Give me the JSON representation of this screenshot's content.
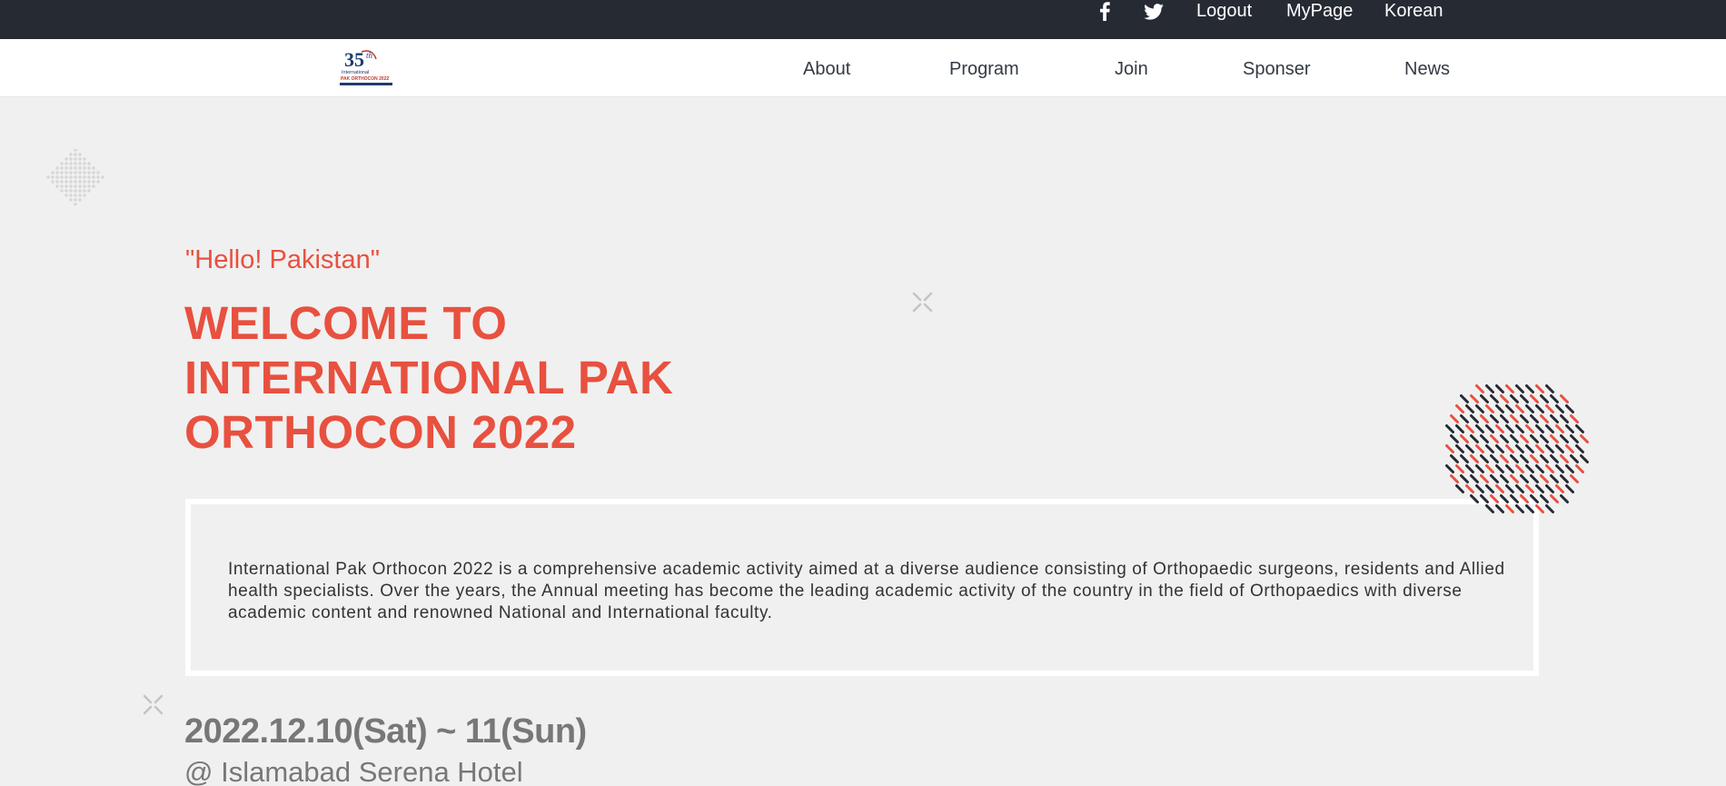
{
  "topbar": {
    "icons": {
      "facebook": "facebook-icon",
      "twitter": "twitter-icon"
    },
    "links": {
      "logout": "Logout",
      "mypage": "MyPage",
      "language": "Korean"
    }
  },
  "navbar": {
    "logo": {
      "badge": "35",
      "suffix": "th",
      "line1": "International",
      "line2": "PAK ORTHOCON 2022"
    },
    "items": [
      "About",
      "Program",
      "Join",
      "Sponser",
      "News"
    ]
  },
  "hero": {
    "subtitle": "\"Hello! Pakistan\"",
    "headline": "WELCOME TO INTERNATIONAL PAK ORTHOCON 2022",
    "description": "International Pak Orthocon 2022 is a comprehensive academic activity aimed at a diverse audience consisting of Orthopaedic surgeons, residents and Allied health specialists. Over the years, the Annual meeting has become the leading academic activity of the country in the field of Orthopaedics with diverse academic content and renowned National and International faculty.",
    "date": "2022.12.10(Sat) ~ 11(Sun)",
    "venue": "@ Islamabad Serena Hotel"
  },
  "colors": {
    "accent": "#e8503f",
    "topbar_bg": "#262a33",
    "page_bg": "#f0f0f0",
    "dark_dash": "#262a33",
    "muted_text": "#777777"
  }
}
